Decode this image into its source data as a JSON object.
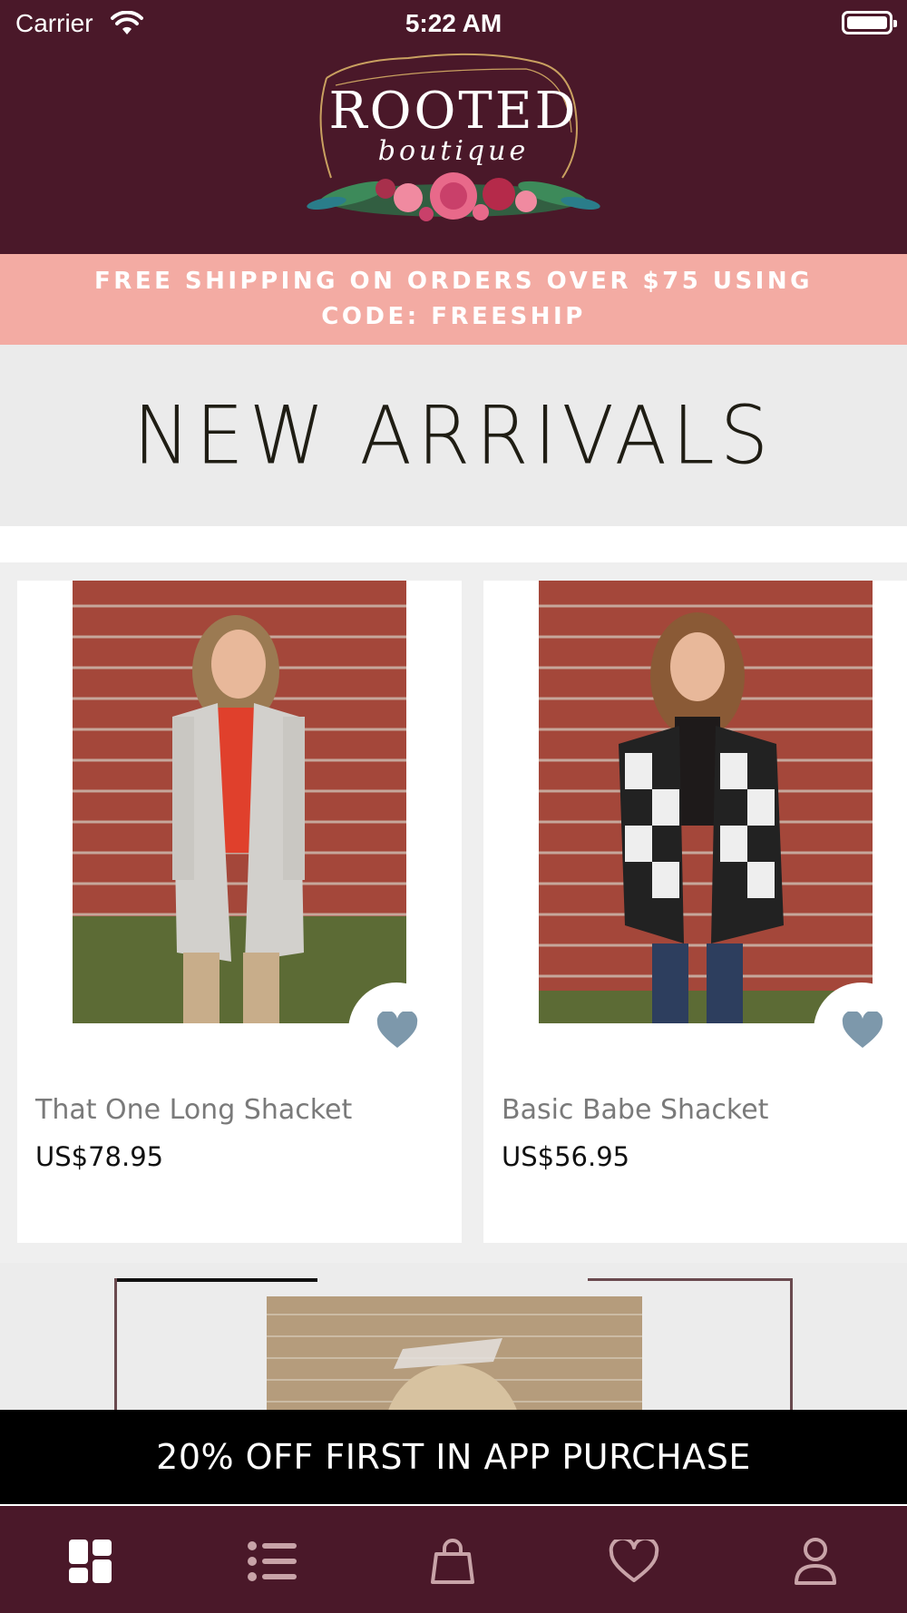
{
  "status_bar": {
    "carrier": "Carrier",
    "time": "5:22 AM"
  },
  "logo": {
    "title": "ROOTED",
    "subtitle": "boutique"
  },
  "promo": {
    "text": "FREE SHIPPING ON ORDERS OVER $75 USING CODE: FREESHIP"
  },
  "banner": {
    "title": "NEW ARRIVALS"
  },
  "products": [
    {
      "name": "That One Long Shacket",
      "price": "US$78.95",
      "favorite_icon": "heart-icon"
    },
    {
      "name": "Basic Babe Shacket",
      "price": "US$56.95",
      "favorite_icon": "heart-icon"
    }
  ],
  "discount_bar": {
    "text": "20% OFF FIRST IN APP PURCHASE"
  },
  "tabbar": {
    "items": [
      {
        "icon": "home-grid-icon",
        "active": true
      },
      {
        "icon": "list-icon",
        "active": false
      },
      {
        "icon": "shopping-bag-icon",
        "active": false
      },
      {
        "icon": "heart-icon",
        "active": false
      },
      {
        "icon": "profile-icon",
        "active": false
      }
    ]
  },
  "colors": {
    "brand_maroon": "#4a1829",
    "promo_pink": "#f3aba3",
    "heart_blue": "#7d98ab",
    "tab_icon": "#c8a3a8"
  }
}
